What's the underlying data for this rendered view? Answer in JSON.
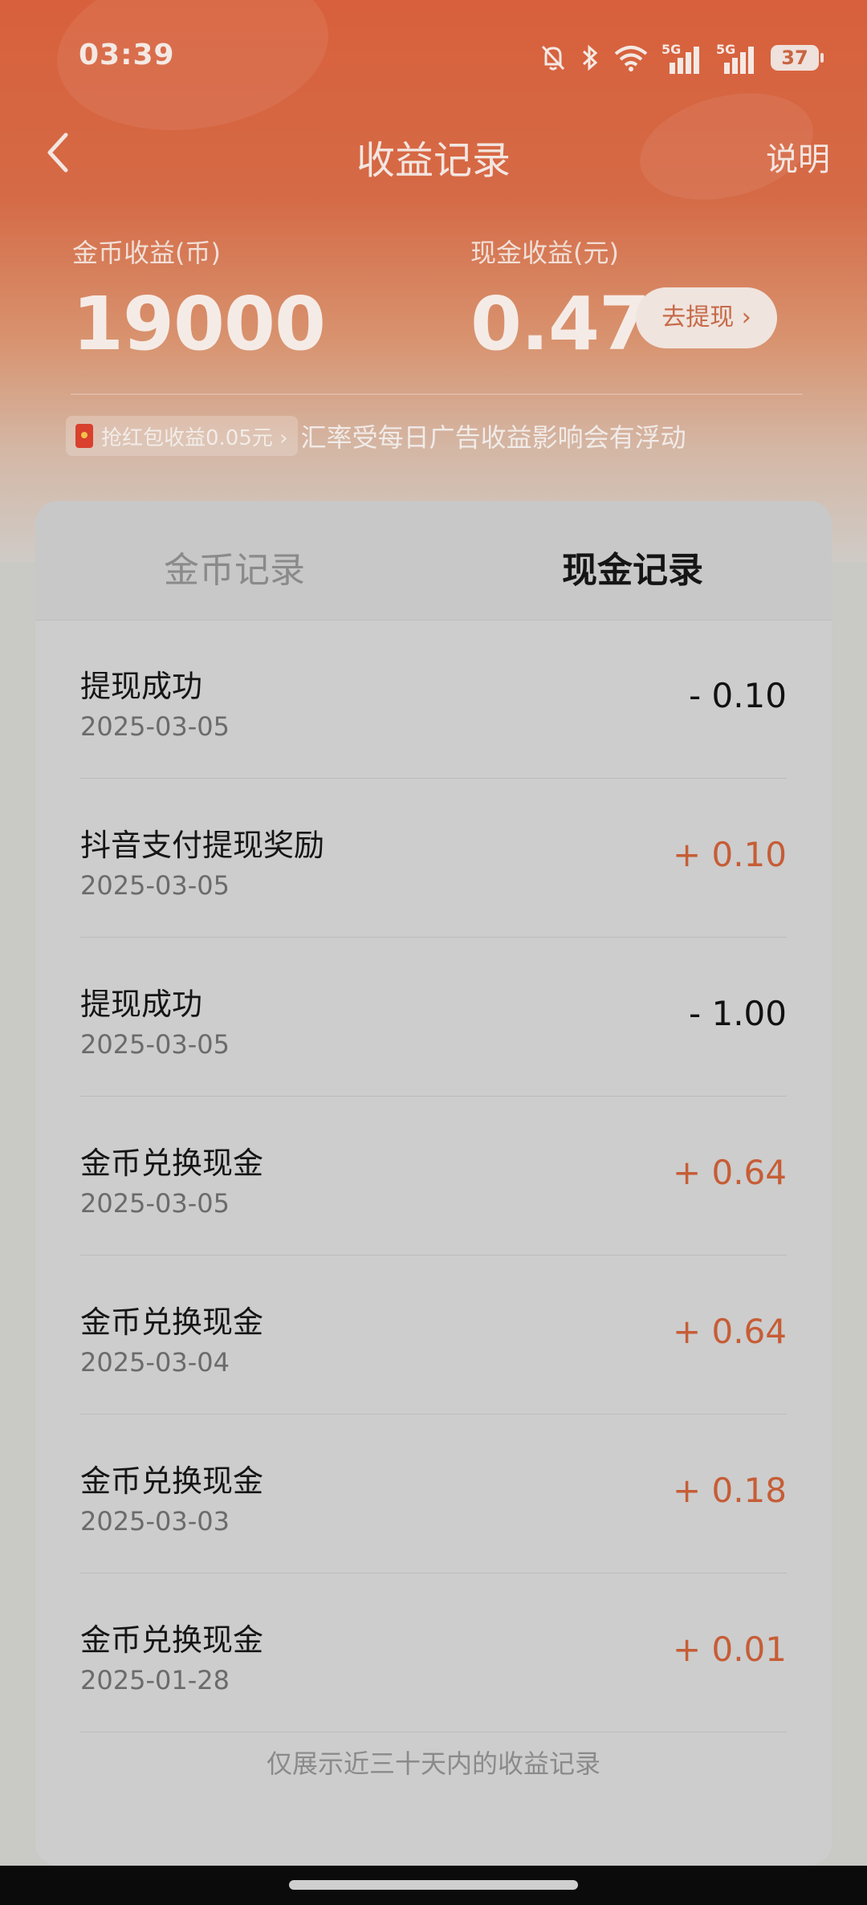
{
  "status_bar": {
    "time": "03:39",
    "signal_1": "5G",
    "signal_2": "5G",
    "battery": "37"
  },
  "nav": {
    "title": "收益记录",
    "help": "说明"
  },
  "earnings": {
    "coin_label": "金币收益(币)",
    "coin_value": "19000",
    "cash_label": "现金收益(元)",
    "cash_value": "0.47",
    "withdraw_label": "去提现 ›"
  },
  "notice": {
    "pill_text": "抢红包收益0.05元 ›",
    "text": "汇率受每日广告收益影响会有浮动"
  },
  "tabs": [
    {
      "label": "金币记录",
      "active": false
    },
    {
      "label": "现金记录",
      "active": true
    }
  ],
  "records": [
    {
      "title": "提现成功",
      "date": "2025-03-05",
      "amount": "- 0.10",
      "sign": "neg"
    },
    {
      "title": "抖音支付提现奖励",
      "date": "2025-03-05",
      "amount": "+ 0.10",
      "sign": "pos"
    },
    {
      "title": "提现成功",
      "date": "2025-03-05",
      "amount": "- 1.00",
      "sign": "neg"
    },
    {
      "title": "金币兑换现金",
      "date": "2025-03-05",
      "amount": "+ 0.64",
      "sign": "pos"
    },
    {
      "title": "金币兑换现金",
      "date": "2025-03-04",
      "amount": "+ 0.64",
      "sign": "pos"
    },
    {
      "title": "金币兑换现金",
      "date": "2025-03-03",
      "amount": "+ 0.18",
      "sign": "pos"
    },
    {
      "title": "金币兑换现金",
      "date": "2025-01-28",
      "amount": "+ 0.01",
      "sign": "pos"
    }
  ],
  "footer_note": "仅展示近三十天内的收益记录",
  "colors": {
    "accent": "#c65d36",
    "header": "#d8603c"
  }
}
